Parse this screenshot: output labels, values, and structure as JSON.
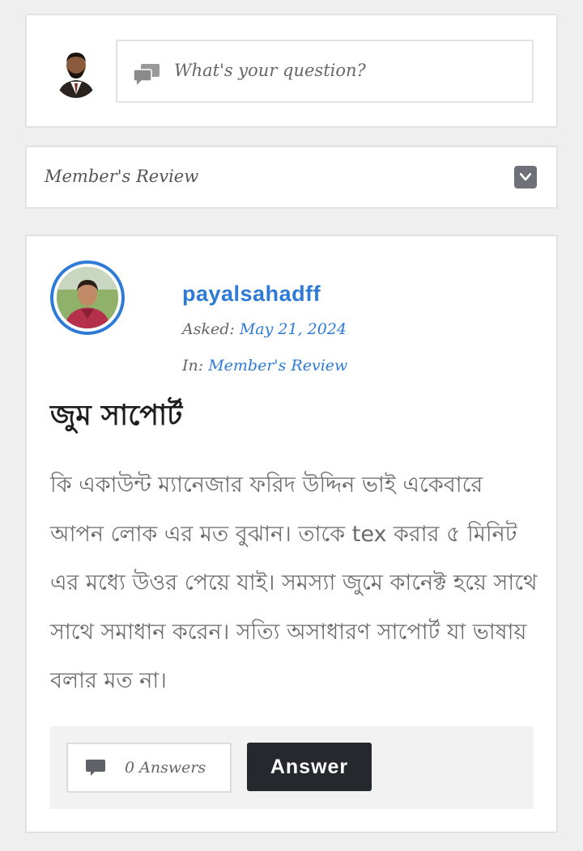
{
  "ask": {
    "placeholder": "What's your question?",
    "icon": "chat-bubbles-icon"
  },
  "category_select": {
    "selected": "Member's Review",
    "icon": "chevron-down-icon"
  },
  "question": {
    "author": "payalsahadff",
    "asked_label": "Asked:",
    "asked_date": "May 21, 2024",
    "in_label": "In:",
    "category": "Member's Review",
    "title": "জুম সাপোর্ট",
    "body": "কি একাউন্ট ম্যানেজার ফরিদ উদ্দিন ভাই একেবারে আপন লোক এর মত বুঝান। তাকে tex করার ৫ মিনিট এর মধ্যে উওর পেয়ে যাই। সমস্যা জুমে কানেক্ট হয়ে সাথে সাথে সমাধান করেন। সত্যি অসাধারণ সাপোর্ট যা ভাষায় বলার মত না।",
    "answers_count": "0 Answers",
    "answer_button": "Answer"
  },
  "colors": {
    "accent": "#2d7bd6",
    "dark_button": "#25282c",
    "background": "#efefef"
  }
}
